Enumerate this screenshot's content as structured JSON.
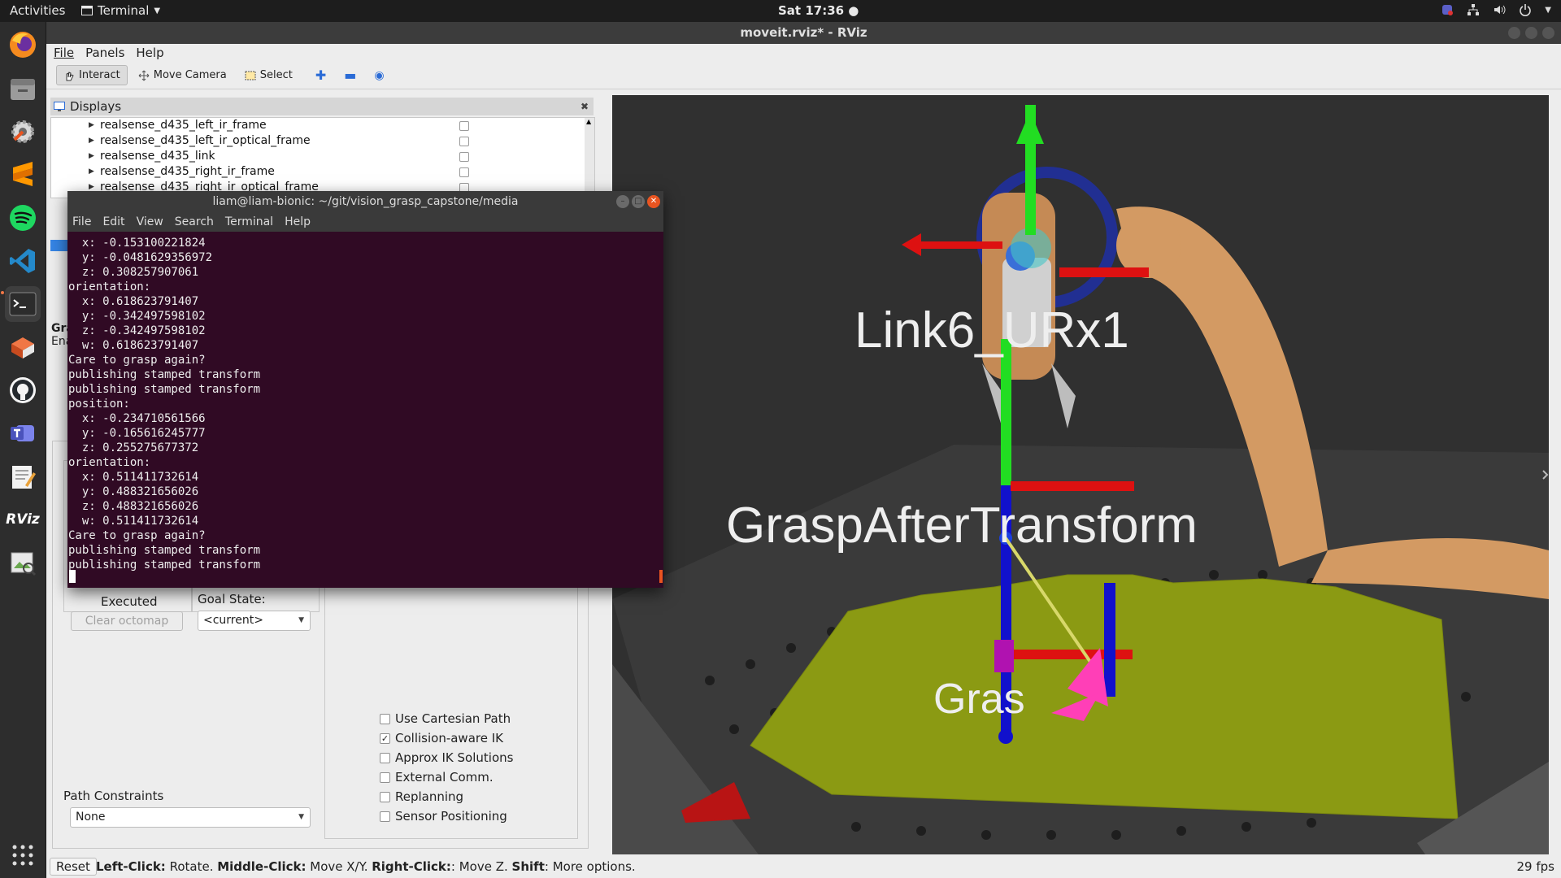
{
  "topbar": {
    "activities": "Activities",
    "app_menu": "Terminal",
    "clock": "Sat 17:36 ●"
  },
  "dock": {
    "items": [
      "firefox-icon",
      "files-icon",
      "settings-icon",
      "sublime-text-icon",
      "spotify-icon",
      "vscode-icon",
      "terminal-icon",
      "ubuntu-software-icon",
      "github-icon",
      "teams-icon",
      "text-editor-icon",
      "rviz-icon",
      "image-viewer-icon"
    ],
    "rviz_label": "RViz"
  },
  "rviz": {
    "window_title": "moveit.rviz* - RViz",
    "menu": [
      "File",
      "Panels",
      "Help"
    ],
    "toolbar": {
      "interact": "Interact",
      "move_camera": "Move Camera",
      "select": "Select"
    },
    "displays": {
      "header": "Displays",
      "rows": [
        "realsense_d435_left_ir_frame",
        "realsense_d435_left_ir_optical_frame",
        "realsense_d435_link",
        "realsense_d435_right_ir_frame",
        "realsense_d435_right_ir_optical_frame"
      ]
    },
    "motion_planning": {
      "partial_label_1": "Gra",
      "partial_label_2": "Ena",
      "executed": "Executed",
      "clear_octomap": "Clear octomap",
      "goal_state_label": "Goal State:",
      "goal_state_value": "<current>",
      "path_constraints_label": "Path Constraints",
      "path_constraints_value": "None",
      "options": [
        {
          "label": "Use Cartesian Path",
          "checked": false
        },
        {
          "label": "Collision-aware IK",
          "checked": true
        },
        {
          "label": "Approx IK Solutions",
          "checked": false
        },
        {
          "label": "External Comm.",
          "checked": false
        },
        {
          "label": "Replanning",
          "checked": false
        },
        {
          "label": "Sensor Positioning",
          "checked": false
        }
      ]
    },
    "view3d": {
      "label_link6": "Link6_URx1",
      "label_grasp_after": "GraspAfterTransform",
      "label_grasp_partial": "Gras"
    },
    "status": {
      "reset": "Reset",
      "hint_left": "Left-Click:",
      "hint_left_action": " Rotate. ",
      "hint_middle": "Middle-Click:",
      "hint_middle_action": " Move X/Y. ",
      "hint_right": "Right-Click:",
      "hint_right_action": ": Move Z. ",
      "hint_shift": "Shift",
      "hint_shift_action": ": More options.",
      "fps": "29 fps"
    }
  },
  "terminal": {
    "title": "liam@liam-bionic: ~/git/vision_grasp_capstone/media",
    "menu": [
      "File",
      "Edit",
      "View",
      "Search",
      "Terminal",
      "Help"
    ],
    "lines": [
      "  x: -0.153100221824",
      "  y: -0.0481629356972",
      "  z: 0.308257907061",
      "orientation:",
      "  x: 0.618623791407",
      "  y: -0.342497598102",
      "  z: -0.342497598102",
      "  w: 0.618623791407",
      "Care to grasp again?",
      "publishing stamped transform",
      "publishing stamped transform",
      "position:",
      "  x: -0.234710561566",
      "  y: -0.165616245777",
      "  z: 0.255275677372",
      "orientation:",
      "  x: 0.511411732614",
      "  y: 0.488321656026",
      "  z: 0.488321656026",
      "  w: 0.511411732614",
      "Care to grasp again?",
      "publishing stamped transform",
      "publishing stamped transform"
    ]
  }
}
